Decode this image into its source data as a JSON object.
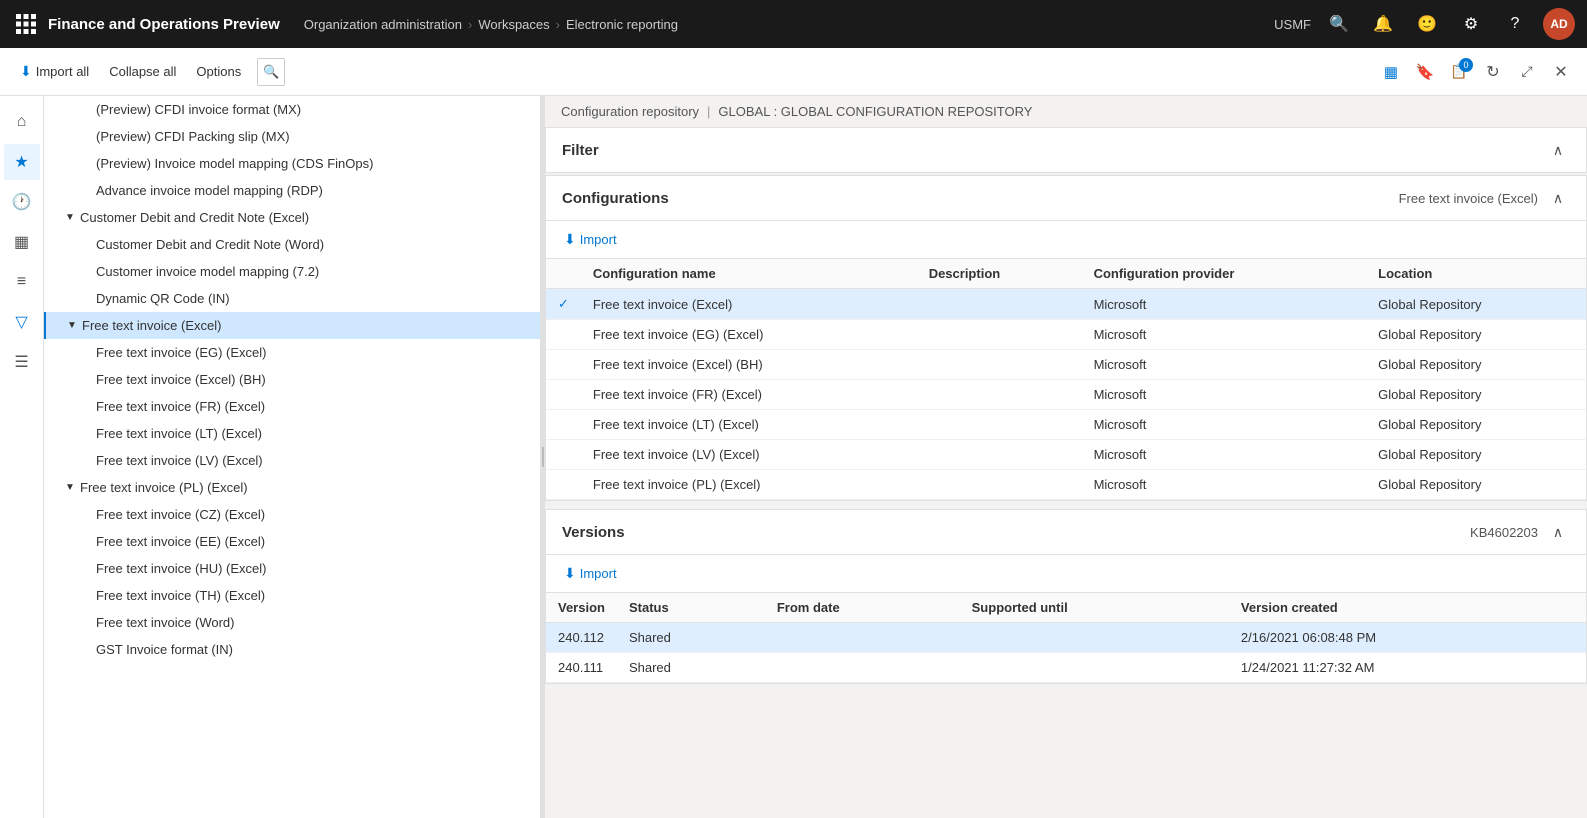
{
  "topnav": {
    "app_title": "Finance and Operations Preview",
    "breadcrumb": {
      "item1": "Organization administration",
      "item2": "Workspaces",
      "item3": "Electronic reporting"
    },
    "env_label": "USMF",
    "avatar_initials": "AD"
  },
  "toolbar": {
    "import_all_label": "Import all",
    "collapse_all_label": "Collapse all",
    "options_label": "Options",
    "badge_count": "0"
  },
  "left_panel": {
    "items": [
      {
        "id": 1,
        "label": "(Preview) CFDI invoice format (MX)",
        "level": "level2",
        "expand": ""
      },
      {
        "id": 2,
        "label": "(Preview) CFDI Packing slip (MX)",
        "level": "level2",
        "expand": ""
      },
      {
        "id": 3,
        "label": "(Preview) Invoice model mapping (CDS FinOps)",
        "level": "level2",
        "expand": ""
      },
      {
        "id": 4,
        "label": "Advance invoice model mapping (RDP)",
        "level": "level2",
        "expand": ""
      },
      {
        "id": 5,
        "label": "Customer Debit and Credit Note (Excel)",
        "level": "level1",
        "expand": "▼",
        "expanded": true
      },
      {
        "id": 6,
        "label": "Customer Debit and Credit Note (Word)",
        "level": "level2",
        "expand": ""
      },
      {
        "id": 7,
        "label": "Customer invoice model mapping (7.2)",
        "level": "level2",
        "expand": ""
      },
      {
        "id": 8,
        "label": "Dynamic QR Code (IN)",
        "level": "level2",
        "expand": ""
      },
      {
        "id": 9,
        "label": "Free text invoice (Excel)",
        "level": "level1",
        "expand": "▼",
        "expanded": true,
        "selected": true
      },
      {
        "id": 10,
        "label": "Free text invoice (EG) (Excel)",
        "level": "level2",
        "expand": ""
      },
      {
        "id": 11,
        "label": "Free text invoice (Excel) (BH)",
        "level": "level2",
        "expand": ""
      },
      {
        "id": 12,
        "label": "Free text invoice (FR) (Excel)",
        "level": "level2",
        "expand": ""
      },
      {
        "id": 13,
        "label": "Free text invoice (LT) (Excel)",
        "level": "level2",
        "expand": ""
      },
      {
        "id": 14,
        "label": "Free text invoice (LV) (Excel)",
        "level": "level2",
        "expand": ""
      },
      {
        "id": 15,
        "label": "Free text invoice (PL) (Excel)",
        "level": "level1",
        "expand": "▼",
        "expanded": true
      },
      {
        "id": 16,
        "label": "Free text invoice (CZ) (Excel)",
        "level": "level2",
        "expand": ""
      },
      {
        "id": 17,
        "label": "Free text invoice (EE) (Excel)",
        "level": "level2",
        "expand": ""
      },
      {
        "id": 18,
        "label": "Free text invoice (HU) (Excel)",
        "level": "level2",
        "expand": ""
      },
      {
        "id": 19,
        "label": "Free text invoice (TH) (Excel)",
        "level": "level2",
        "expand": ""
      },
      {
        "id": 20,
        "label": "Free text invoice (Word)",
        "level": "level2",
        "expand": ""
      },
      {
        "id": 21,
        "label": "GST Invoice format (IN)",
        "level": "level2",
        "expand": ""
      }
    ]
  },
  "right_panel": {
    "breadcrumb1": "Configuration repository",
    "breadcrumb2": "GLOBAL : GLOBAL CONFIGURATION REPOSITORY",
    "filter_title": "Filter",
    "configurations_title": "Configurations",
    "configurations_label": "Free text invoice (Excel)",
    "import_label": "Import",
    "table_headers": {
      "check": "",
      "name": "Configuration name",
      "description": "Description",
      "provider": "Configuration provider",
      "location": "Location"
    },
    "configurations_rows": [
      {
        "id": 1,
        "name": "Free text invoice (Excel)",
        "description": "",
        "provider": "Microsoft",
        "location": "Global Repository",
        "selected": true
      },
      {
        "id": 2,
        "name": "Free text invoice (EG) (Excel)",
        "description": "",
        "provider": "Microsoft",
        "location": "Global Repository"
      },
      {
        "id": 3,
        "name": "Free text invoice (Excel) (BH)",
        "description": "",
        "provider": "Microsoft",
        "location": "Global Repository"
      },
      {
        "id": 4,
        "name": "Free text invoice (FR) (Excel)",
        "description": "",
        "provider": "Microsoft",
        "location": "Global Repository"
      },
      {
        "id": 5,
        "name": "Free text invoice (LT) (Excel)",
        "description": "",
        "provider": "Microsoft",
        "location": "Global Repository"
      },
      {
        "id": 6,
        "name": "Free text invoice (LV) (Excel)",
        "description": "",
        "provider": "Microsoft",
        "location": "Global Repository"
      },
      {
        "id": 7,
        "name": "Free text invoice (PL) (Excel)",
        "description": "",
        "provider": "Microsoft",
        "location": "Global Repository"
      }
    ],
    "versions_title": "Versions",
    "versions_label": "KB4602203",
    "versions_import_label": "Import",
    "versions_headers": {
      "version": "Version",
      "status": "Status",
      "from_date": "From date",
      "supported_until": "Supported until",
      "version_created": "Version created"
    },
    "versions_rows": [
      {
        "id": 1,
        "version": "240.112",
        "status": "Shared",
        "from_date": "",
        "supported_until": "",
        "version_created": "2/16/2021 06:08:48 PM",
        "selected": true
      },
      {
        "id": 2,
        "version": "240.111",
        "status": "Shared",
        "from_date": "",
        "supported_until": "",
        "version_created": "1/24/2021 11:27:32 AM"
      }
    ]
  }
}
